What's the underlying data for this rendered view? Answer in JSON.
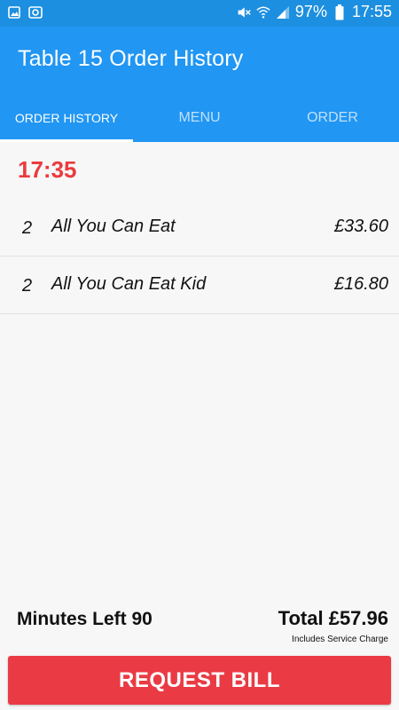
{
  "status_bar": {
    "left_icons": [
      "gallery-icon",
      "camera-notification-icon"
    ],
    "right_icons": [
      "mute-icon",
      "wifi-icon",
      "signal-icon",
      "battery-icon"
    ],
    "battery": "97%",
    "time": "17:55"
  },
  "app_bar": {
    "title": "Table 15 Order History"
  },
  "tabs": [
    {
      "label": "ORDER HISTORY",
      "active": true
    },
    {
      "label": "MENU",
      "active": false
    },
    {
      "label": "ORDER",
      "active": false
    }
  ],
  "order_time": "17:35",
  "orders": [
    {
      "qty": "2",
      "name": "All You Can Eat",
      "price": "£33.60"
    },
    {
      "qty": "2",
      "name": "All You Can Eat Kid",
      "price": "£16.80"
    }
  ],
  "footer": {
    "minutes_left": "Minutes Left 90",
    "total": "Total £57.96",
    "service_note": "Includes Service Charge",
    "request_bill": "REQUEST BILL"
  },
  "colors": {
    "primary": "#2196f3",
    "status_bar": "#1d8fe0",
    "accent_red": "#ea3b3f",
    "button_red": "#ea3b45"
  }
}
